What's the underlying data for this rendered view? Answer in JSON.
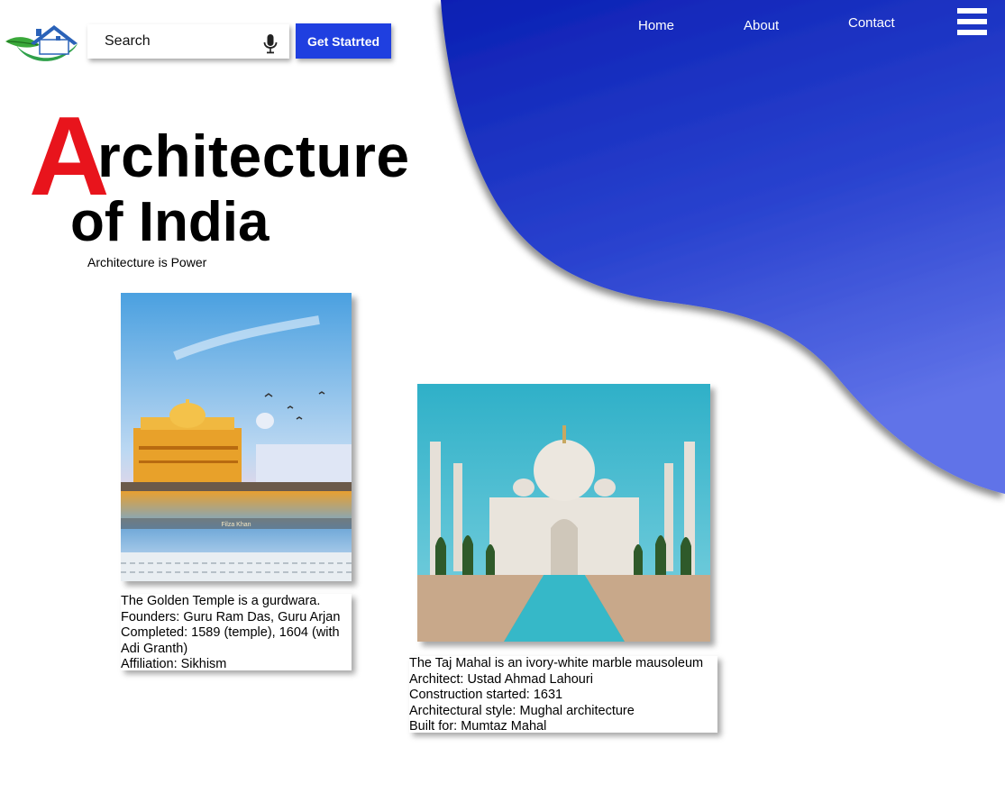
{
  "header": {
    "search": {
      "placeholder": "Search",
      "icon": "mic-icon"
    },
    "cta_label": "Get Statrted",
    "nav": [
      "Home",
      "About",
      "Contact"
    ],
    "menu_icon": "hamburger-menu-icon",
    "logo_icon": "house-leaf-logo-icon"
  },
  "hero": {
    "title_initial": "A",
    "title_rest": "rchitecture",
    "title_line2": "of India",
    "tagline": "Architecture is Power"
  },
  "cards": [
    {
      "image": "golden-temple-photo",
      "image_watermark": "Filza Khan",
      "lines": [
        "The Golden Temple is a gurdwara.",
        "Founders: Guru Ram Das, Guru Arjan",
        "Completed: 1589 (temple), 1604 (with Adi Granth)",
        "Affiliation: Sikhism"
      ]
    },
    {
      "image": "taj-mahal-photo",
      "lines": [
        "The Taj Mahal is an ivory-white marble mausoleum",
        "Architect: Ustad Ahmad Lahouri",
        "Construction started: 1631",
        "Architectural style: Mughal architecture",
        "Built for: Mumtaz Mahal"
      ]
    }
  ],
  "colors": {
    "accent_blue": "#1f3fe0",
    "blob_dark": "#1024b8",
    "blob_light": "#5b6fe6",
    "title_red": "#e8141c"
  }
}
